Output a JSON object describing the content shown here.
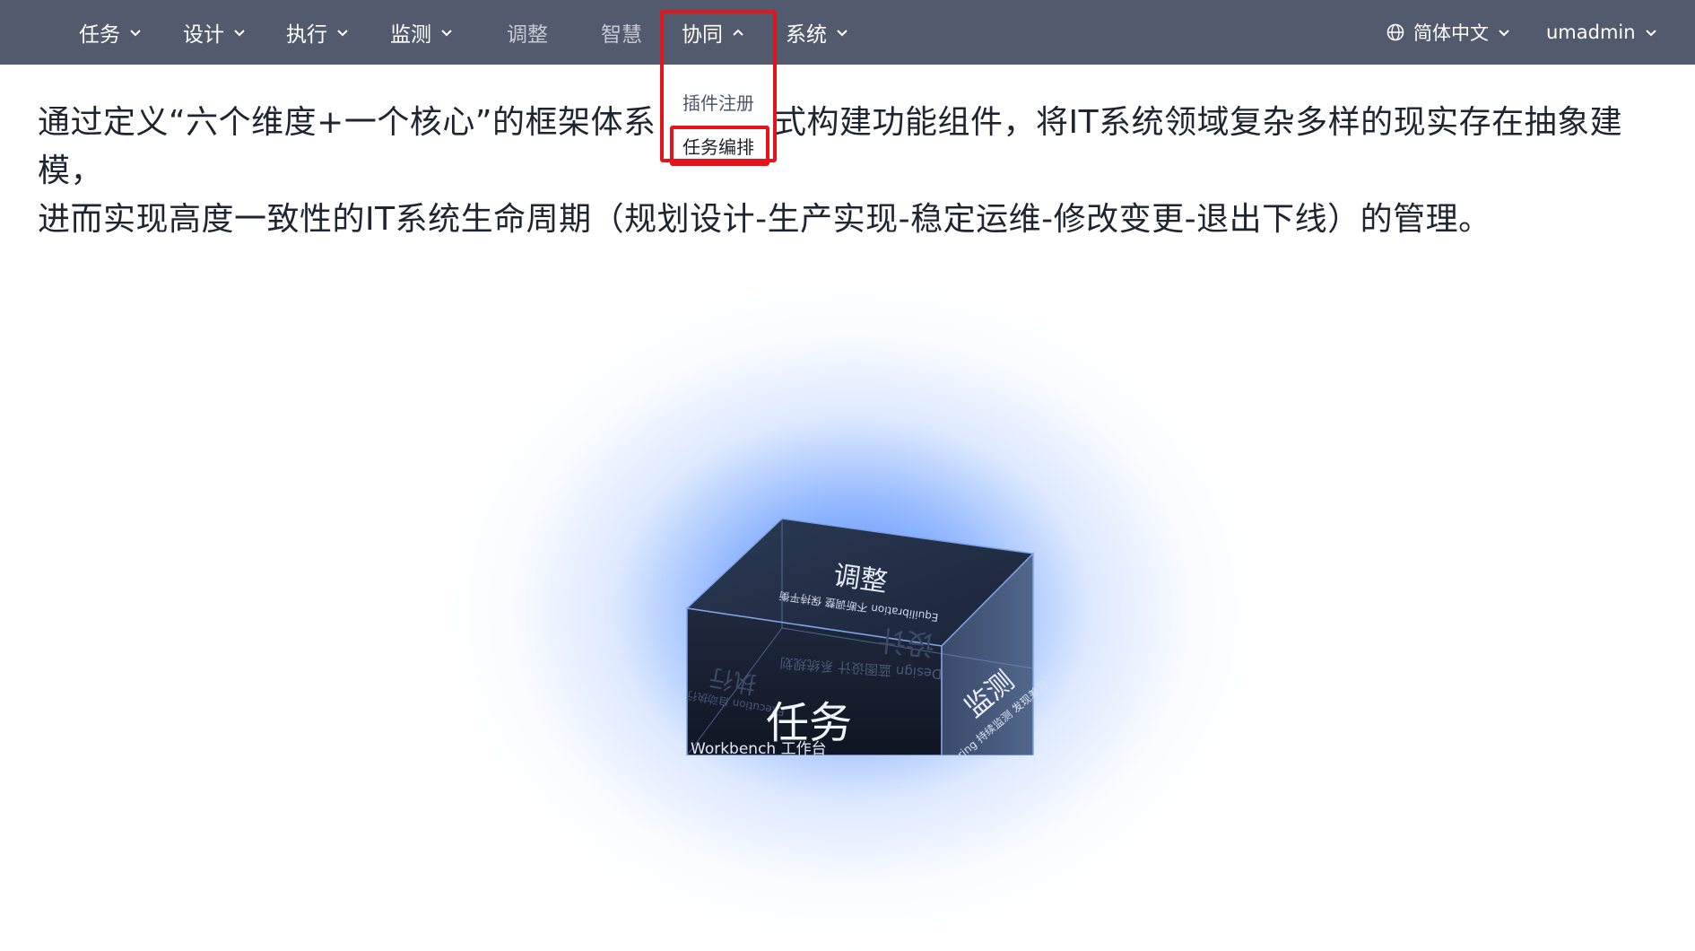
{
  "nav": {
    "items": [
      {
        "label": "任务"
      },
      {
        "label": "设计"
      },
      {
        "label": "执行"
      },
      {
        "label": "监测"
      },
      {
        "label": "调整"
      },
      {
        "label": "智慧"
      },
      {
        "label": "协同"
      },
      {
        "label": "系统"
      }
    ],
    "language": "简体中文",
    "user": "umadmin",
    "icons": {
      "language": "globe-icon",
      "chevron": "chevron-down-icon",
      "chevron_open": "chevron-up-icon"
    }
  },
  "dropdown": {
    "items": [
      {
        "label": "插件注册"
      },
      {
        "label": "任务编排"
      }
    ],
    "highlight_color": "#e3141c"
  },
  "intro": {
    "line1": "通过定义“六个维度+一个核心”的框架体系，",
    "line1b": "式构建功能组件，将IT系统领域复杂多样的现实存在抽象建模，",
    "line2": "进而实现高度一致性的IT系统生命周期（规划设计-生产实现-稳定运维-修改变更-退出下线）的管理。"
  },
  "cube": {
    "top_title": "调整",
    "top_sub": "Equilibration 不断调整 保持平衡",
    "front_title": "任务",
    "front_sub": "Workbench 工作台",
    "right_title": "监测",
    "right_sub": "Monitoring 持续监测 发现差异",
    "back_title": "设计",
    "back_sub": "Design 蓝图设计 系统规划",
    "left_title": "执行",
    "left_sub": "Execution 自动执行",
    "colors": {
      "glow": "#4682ff",
      "face": "#1a2233"
    }
  },
  "colors": {
    "topbar": "#525a6d",
    "text": "#1e2430"
  }
}
